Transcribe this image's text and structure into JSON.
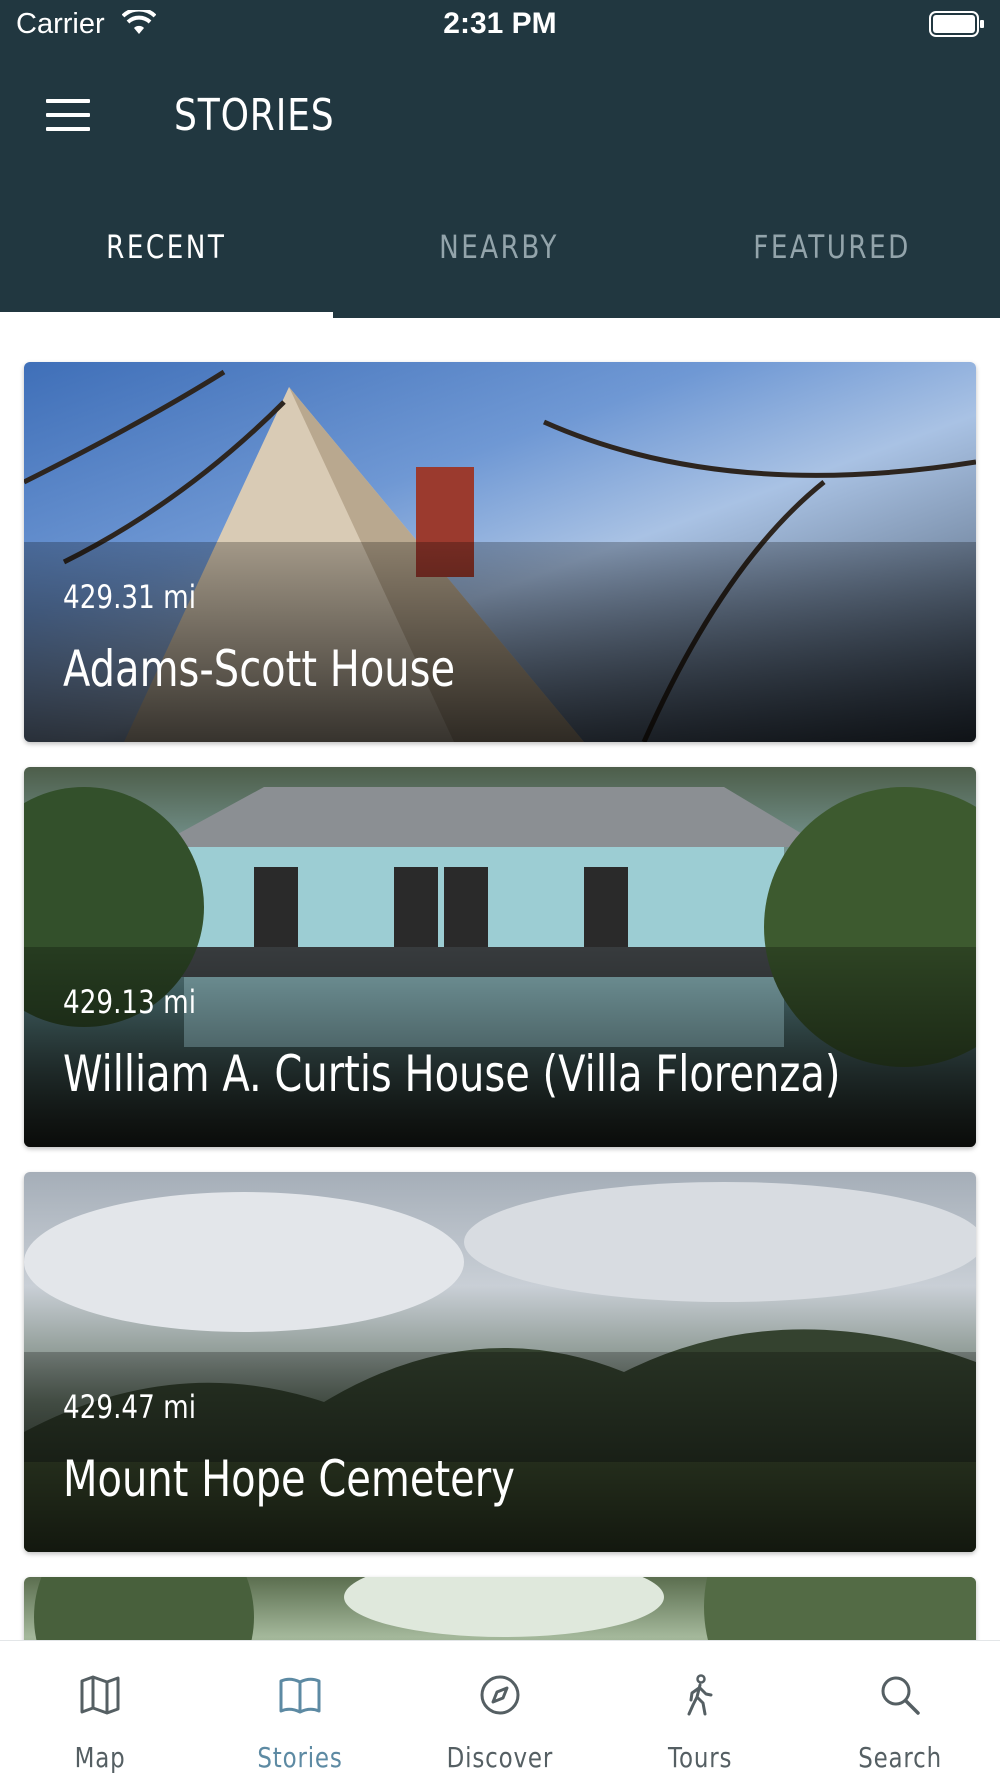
{
  "status_bar": {
    "carrier": "Carrier",
    "time": "2:31 PM"
  },
  "header": {
    "title": "STORIES"
  },
  "tabs": [
    {
      "label": "RECENT",
      "active": true
    },
    {
      "label": "NEARBY",
      "active": false
    },
    {
      "label": "FEATURED",
      "active": false
    }
  ],
  "stories": [
    {
      "distance": "429.31 mi",
      "name": "Adams-Scott House"
    },
    {
      "distance": "429.13 mi",
      "name": "William A. Curtis House (Villa Florenza)"
    },
    {
      "distance": "429.47 mi",
      "name": "Mount Hope Cemetery"
    }
  ],
  "bottom_nav": [
    {
      "label": "Map",
      "icon": "map-icon",
      "active": false
    },
    {
      "label": "Stories",
      "icon": "book-icon",
      "active": true
    },
    {
      "label": "Discover",
      "icon": "compass-icon",
      "active": false
    },
    {
      "label": "Tours",
      "icon": "walking-icon",
      "active": false
    },
    {
      "label": "Search",
      "icon": "search-icon",
      "active": false
    }
  ],
  "colors": {
    "header_bg": "#213740",
    "active_nav": "#5d8aa3",
    "inactive_nav": "#555f63",
    "inactive_tab": "#93a4ab"
  }
}
